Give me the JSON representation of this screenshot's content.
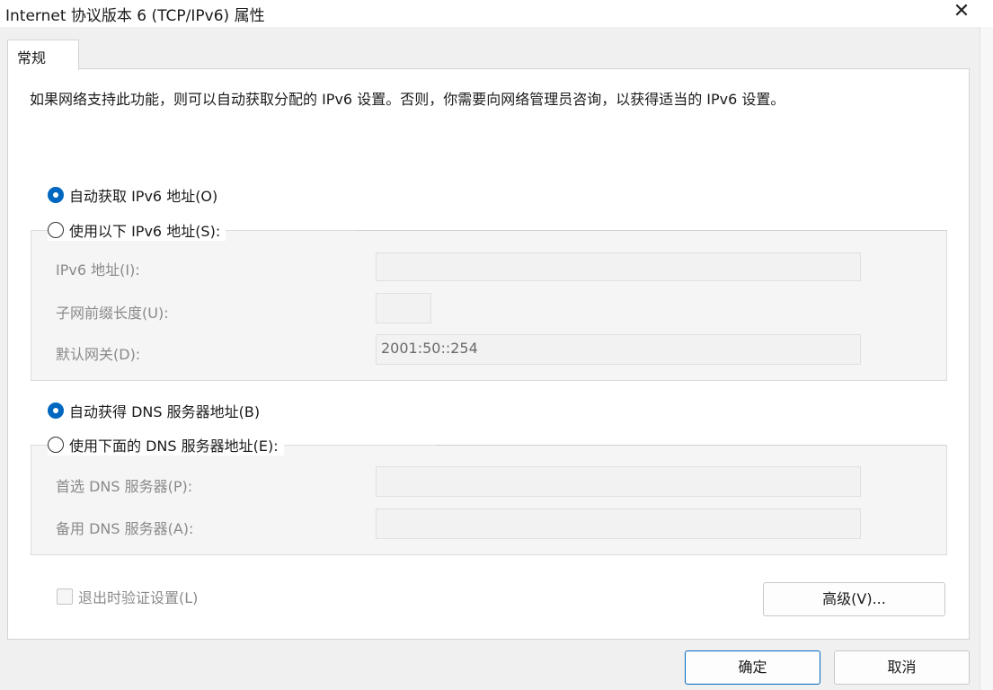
{
  "window": {
    "title": "Internet 协议版本 6 (TCP/IPv6) 属性",
    "close_icon": "✕"
  },
  "tabs": [
    {
      "label": "常规"
    }
  ],
  "description": "如果网络支持此功能，则可以自动获取分配的 IPv6 设置。否则，你需要向网络管理员咨询，以获得适当的 IPv6 设置。",
  "ip_section": {
    "auto_radio": {
      "label": "自动获取 IPv6 地址(O)",
      "checked": true
    },
    "manual_radio": {
      "label": "使用以下 IPv6 地址(S):",
      "checked": false
    },
    "fields": [
      {
        "label": "IPv6 地址(I):",
        "value": ""
      },
      {
        "label": "子网前缀长度(U):",
        "value": ""
      },
      {
        "label": "默认网关(D):",
        "value": "2001:50::254"
      }
    ]
  },
  "dns_section": {
    "auto_radio": {
      "label": "自动获得 DNS 服务器地址(B)",
      "checked": true
    },
    "manual_radio": {
      "label": "使用下面的 DNS 服务器地址(E):",
      "checked": false
    },
    "fields": [
      {
        "label": "首选 DNS 服务器(P):",
        "value": ""
      },
      {
        "label": "备用 DNS 服务器(A):",
        "value": ""
      }
    ]
  },
  "validate_checkbox": {
    "label": "退出时验证设置(L)",
    "checked": false
  },
  "buttons": {
    "advanced": "高级(V)...",
    "ok": "确定",
    "cancel": "取消"
  },
  "colors": {
    "accent": "#0067c0",
    "panel_bg": "#ffffff",
    "window_bg": "#f0f0f0",
    "disabled_text": "#8a8a8a"
  }
}
